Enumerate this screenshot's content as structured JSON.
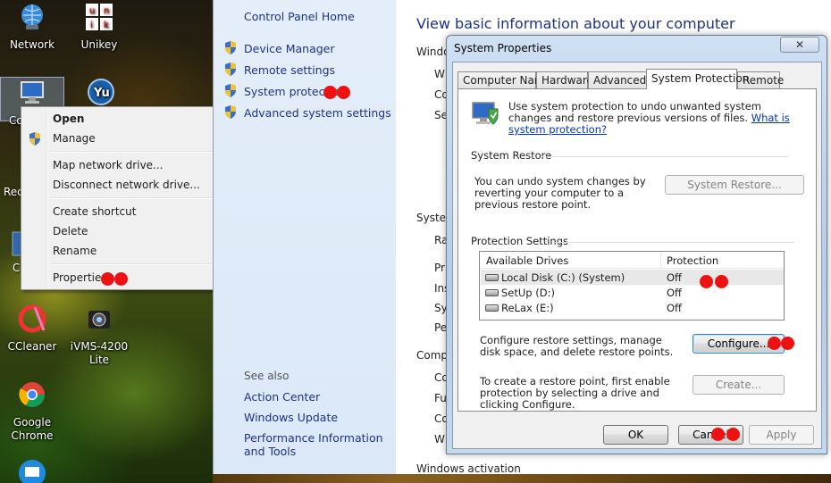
{
  "desktop": {
    "icons": [
      {
        "label": "Network"
      },
      {
        "label": "Unikey"
      },
      {
        "label": "Co"
      },
      {
        "label": "Rec"
      },
      {
        "label": "C"
      },
      {
        "label": "CCleaner"
      },
      {
        "label": "iVMS-4200 Lite"
      },
      {
        "label": "Google Chrome"
      },
      {
        "label": "Unikey-logo",
        "glyph": "u n i k"
      }
    ]
  },
  "context_menu": {
    "items": [
      "Open",
      "Manage",
      "Map network drive...",
      "Disconnect network drive...",
      "Create shortcut",
      "Delete",
      "Rename",
      "Properties"
    ]
  },
  "control_panel": {
    "home": "Control Panel Home",
    "links": [
      "Device Manager",
      "Remote settings",
      "System protection",
      "Advanced system settings"
    ],
    "see_also": "See also",
    "see_also_links": [
      "Action Center",
      "Windows Update",
      "Performance Information and Tools"
    ],
    "title": "View basic information about your computer",
    "fragments": [
      "Windo",
      "W",
      "Co",
      "Se",
      "Syster",
      "Ra",
      "Pr",
      "Ins",
      "Sy",
      "Pe",
      "Comp",
      "Co",
      "Fu",
      "Co",
      "W",
      "Windows activation"
    ]
  },
  "dialog": {
    "title": "System Properties",
    "close_glyph": "✕",
    "tabs": [
      "Computer Name",
      "Hardware",
      "Advanced",
      "System Protection",
      "Remote"
    ],
    "active_tab": "System Protection",
    "intro": "Use system protection to undo unwanted system changes and restore previous versions of files.",
    "intro_link": "What is system protection?",
    "system_restore": {
      "heading": "System Restore",
      "text": "You can undo system changes by reverting your computer to a previous restore point.",
      "button": "System Restore..."
    },
    "protection": {
      "heading": "Protection Settings",
      "columns": [
        "Available Drives",
        "Protection"
      ],
      "drives": [
        {
          "name": "Local Disk (C:) (System)",
          "protection": "Off"
        },
        {
          "name": "SetUp (D:)",
          "protection": "Off"
        },
        {
          "name": "ReLax (E:)",
          "protection": "Off"
        }
      ],
      "configure_text": "Configure restore settings, manage disk space, and delete restore points.",
      "configure_button": "Configure...",
      "create_text": "To create a restore point, first enable protection by selecting a drive and clicking Configure.",
      "create_button": "Create..."
    },
    "buttons": {
      "ok": "OK",
      "cancel": "Cancel",
      "apply": "Apply"
    }
  },
  "colors": {
    "link": "#1e3287",
    "accent_dot": "#ee1111",
    "panel_bg": "#dbe8f7"
  }
}
